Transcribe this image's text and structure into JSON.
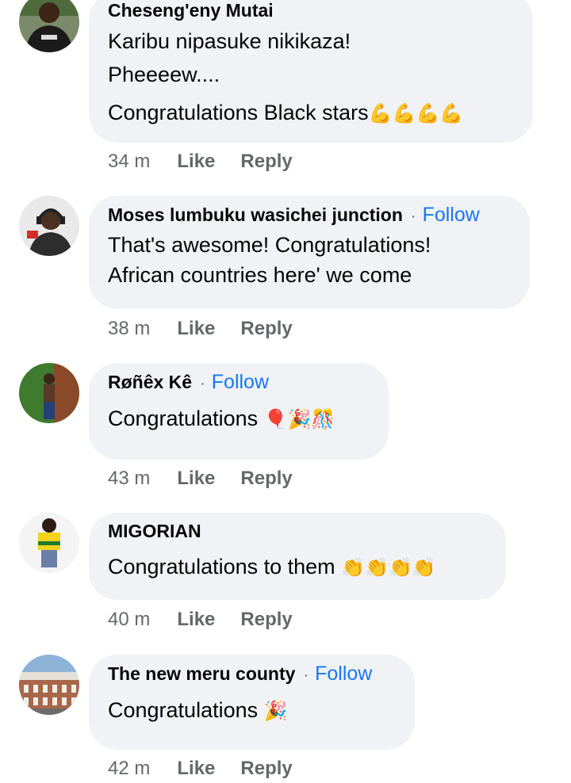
{
  "comments": [
    {
      "author": "Cheseng'eny Mutai",
      "show_follow": false,
      "lines": [
        "Karibu nipasuke nikikaza!",
        "Pheeeew....",
        "Congratulations Black stars"
      ],
      "emojis": [
        "💪",
        "💪",
        "💪",
        "💪"
      ],
      "time": "34 m",
      "avatar": "avatar-person-dark-shirt"
    },
    {
      "author": "Moses lumbuku wasichei junction",
      "show_follow": true,
      "lines": [
        "That's awesome! Congratulations!",
        "African countries here' we come"
      ],
      "emojis": [],
      "time": "38 m",
      "avatar": "avatar-person-headset"
    },
    {
      "author": "Røñêx Kê",
      "show_follow": true,
      "lines": [
        "Congratulations"
      ],
      "emojis": [
        "🎈",
        "🎉",
        "🎊"
      ],
      "time": "43 m",
      "avatar": "avatar-person-outdoors"
    },
    {
      "author": "MIGORIAN",
      "show_follow": false,
      "lines": [
        "Congratulations to them"
      ],
      "emojis": [
        "👏",
        "👏",
        "👏",
        "👏"
      ],
      "time": "40 m",
      "avatar": "avatar-person-yellow-shirt"
    },
    {
      "author": "The new meru county",
      "show_follow": true,
      "lines": [
        "Congratulations"
      ],
      "emojis": [
        "🎉"
      ],
      "time": "42 m",
      "avatar": "avatar-building"
    }
  ],
  "labels": {
    "follow": "Follow",
    "like": "Like",
    "reply": "Reply",
    "separator": "·"
  },
  "colors": {
    "bubble": "#f0f2f5",
    "follow": "#1877f2",
    "meta": "#65676b",
    "text": "#050505"
  }
}
